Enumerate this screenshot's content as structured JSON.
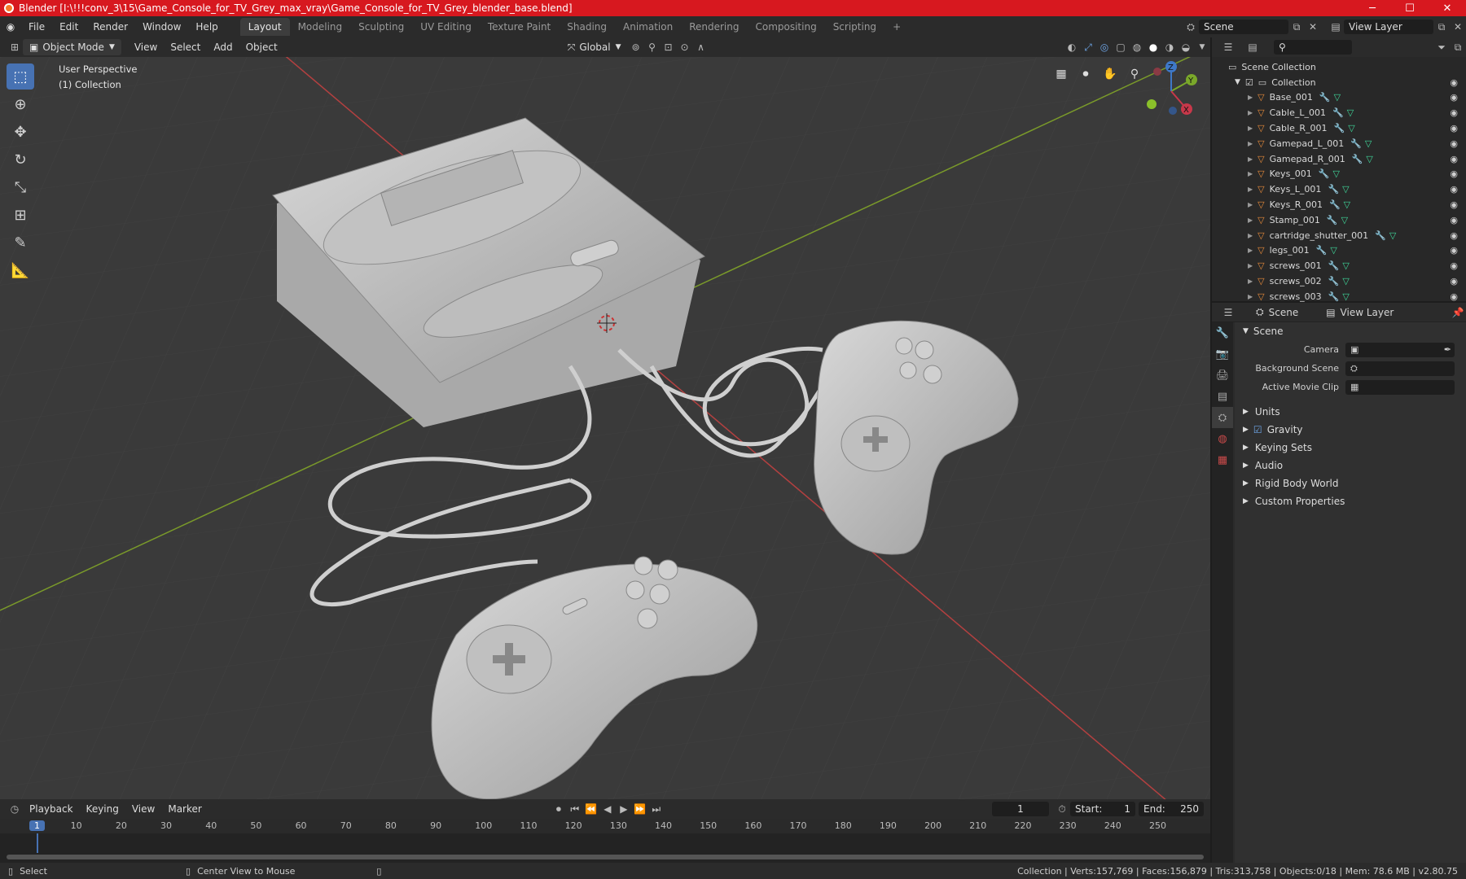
{
  "titlebar": {
    "title": "Blender [I:\\!!!conv_3\\15\\Game_Console_for_TV_Grey_max_vray\\Game_Console_for_TV_Grey_blender_base.blend]",
    "min": "─",
    "max": "☐",
    "close": "✕"
  },
  "menu": {
    "items": [
      "File",
      "Edit",
      "Render",
      "Window",
      "Help"
    ]
  },
  "workspaces": [
    "Layout",
    "Modeling",
    "Sculpting",
    "UV Editing",
    "Texture Paint",
    "Shading",
    "Animation",
    "Rendering",
    "Compositing",
    "Scripting"
  ],
  "add_tab": "+",
  "scene_field": "Scene",
  "view_layer_field": "View Layer",
  "viewport_header": {
    "mode": "Object Mode",
    "view": "View",
    "select": "Select",
    "add": "Add",
    "object": "Object",
    "orientation": "Global"
  },
  "viewport": {
    "info_line1": "User Perspective",
    "info_line2": "(1) Collection"
  },
  "gizmo": {
    "x": "X",
    "y": "Y",
    "z": "Z"
  },
  "outliner": {
    "scene_collection": "Scene Collection",
    "collection": "Collection",
    "items": [
      "Base_001",
      "Cable_L_001",
      "Cable_R_001",
      "Gamepad_L_001",
      "Gamepad_R_001",
      "Keys_001",
      "Keys_L_001",
      "Keys_R_001",
      "Stamp_001",
      "cartridge_shutter_001",
      "legs_001",
      "screws_001",
      "screws_002",
      "screws_003"
    ]
  },
  "properties": {
    "tab_scene": "Scene",
    "tab_view_layer": "View Layer",
    "panel_scene": "Scene",
    "camera_label": "Camera",
    "background_label": "Background Scene",
    "clip_label": "Active Movie Clip",
    "panels": [
      "Units",
      "Gravity",
      "Keying Sets",
      "Audio",
      "Rigid Body World",
      "Custom Properties"
    ]
  },
  "timeline": {
    "playback": "Playback",
    "keying": "Keying",
    "view": "View",
    "marker": "Marker",
    "current_frame": "1",
    "start_label": "Start:",
    "start": "1",
    "end_label": "End:",
    "end": "250",
    "ticks": [
      "1",
      "10",
      "20",
      "30",
      "40",
      "50",
      "60",
      "70",
      "80",
      "90",
      "100",
      "110",
      "120",
      "130",
      "140",
      "150",
      "160",
      "170",
      "180",
      "190",
      "200",
      "210",
      "220",
      "230",
      "240",
      "250"
    ]
  },
  "status": {
    "select": "Select",
    "center": "Center View to Mouse",
    "stats": "Collection | Verts:157,769 | Faces:156,879 | Tris:313,758 | Objects:0/18 | Mem: 78.6 MB | v2.80.75"
  }
}
